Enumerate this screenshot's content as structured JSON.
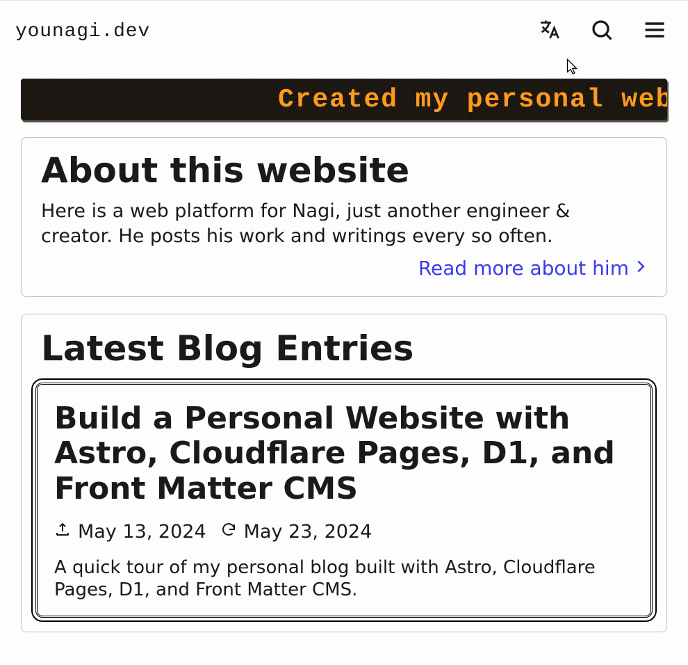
{
  "site": {
    "title": "younagi.dev"
  },
  "marquee": {
    "text": "Created my personal websi"
  },
  "about": {
    "heading": "About this website",
    "body": "Here is a web platform for Nagi, just another engineer & creator. He posts his work and writings every so often.",
    "readMoreLabel": "Read more about him"
  },
  "blogSection": {
    "heading": "Latest Blog Entries"
  },
  "blogEntries": [
    {
      "title": "Build a Personal Website with Astro, Cloudflare Pages, D1, and Front Matter CMS",
      "publishedDate": "May 13, 2024",
      "updatedDate": "May 23, 2024",
      "excerpt": "A quick tour of my personal blog built with Astro, Cloudflare Pages, D1, and Front Matter CMS."
    }
  ],
  "colors": {
    "accent": "#3b3beb",
    "marqueeText": "#ff9a1f",
    "marqueeBg": "#1a1612"
  }
}
